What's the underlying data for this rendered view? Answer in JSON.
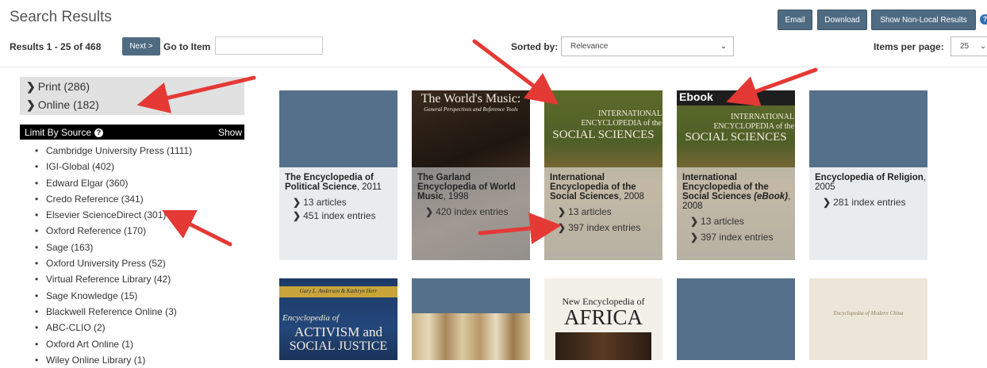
{
  "header": {
    "title": "Search Results",
    "results_count": "Results 1 - 25 of 468",
    "next_label": "Next >",
    "goto_label": "Go to Item",
    "goto_value": "",
    "sorted_label": "Sorted by:",
    "sort_value": "Relevance",
    "ipp_label": "Items per page:",
    "ipp_value": "25",
    "email_label": "Email",
    "download_label": "Download",
    "nonlocal_label": "Show Non-Local Results"
  },
  "facets": [
    {
      "label": "Print (286)"
    },
    {
      "label": "Online (182)"
    }
  ],
  "limit_by_source": {
    "label": "Limit By Source",
    "show_label": "Show",
    "sources": [
      "Cambridge University Press (1111)",
      "IGI-Global (402)",
      "Edward Elgar (360)",
      "Credo Reference (341)",
      "Elsevier ScienceDirect (301)",
      "Oxford Reference (170)",
      "Sage (163)",
      "Oxford University Press (52)",
      "Virtual Reference Library (42)",
      "Sage Knowledge (15)",
      "Blackwell Reference Online (3)",
      "ABC-CLIO (2)",
      "Oxford Art Online (1)",
      "Wiley Online Library (1)"
    ]
  },
  "cards": [
    {
      "title": "The Encyclopedia of Political Science",
      "year": ", 2011",
      "links": [
        "13 articles",
        "451 index entries"
      ]
    },
    {
      "title": "The Garland Encyclopedia of World Music",
      "year": ", 1998",
      "cover_title": "The World's Music:",
      "cover_sub": "General Perspectives and Reference Tools",
      "links": [
        "420 index entries"
      ]
    },
    {
      "title": "International Encyclopedia of the Social Sciences",
      "year": ", 2008",
      "cover_lines": [
        "INTERNATIONAL",
        "ENCYCLOPEDIA of the",
        "SOCIAL SCIENCES"
      ],
      "links": [
        "13 articles",
        "397 index entries"
      ]
    },
    {
      "title": "International Encyclopedia of the Social Sciences",
      "title_em": "(eBook)",
      "year": ", 2008",
      "tag": "Ebook",
      "cover_lines": [
        "INTERNATIONAL",
        "ENCYCLOPEDIA of the",
        "SOCIAL SCIENCES"
      ],
      "links": [
        "13 articles",
        "397 index entries"
      ]
    },
    {
      "title": "Encyclopedia of Religion",
      "year": ", 2005",
      "links": [
        "281 index entries"
      ]
    }
  ],
  "row2": {
    "card1_author": "Gary L. Anderson & Kathryn Herr",
    "card1_lines": [
      "Encyclopedia of",
      "ACTIVISM and",
      "SOCIAL JUSTICE"
    ],
    "card3_lines": [
      "New Encyclopedia of",
      "AFRICA"
    ],
    "card5_line": "Encyclopedia of Modern China"
  },
  "colors": {
    "button_bg": "#4f6b82",
    "placeholder_cover": "#55708a",
    "arrow_red": "#e53935"
  }
}
